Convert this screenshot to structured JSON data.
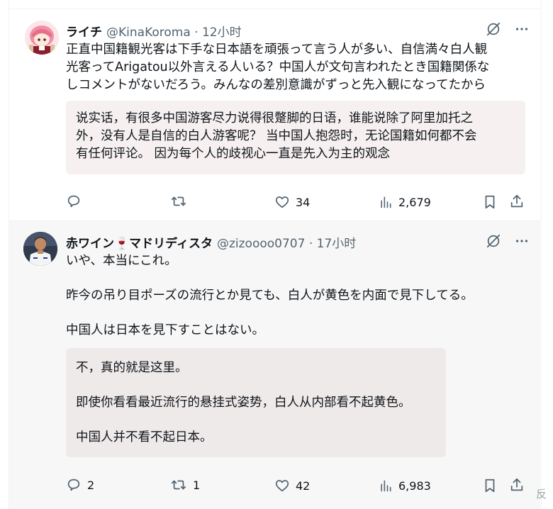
{
  "tweets": [
    {
      "author_name": "ライチ",
      "handle_time": "@KinaKoroma · 12小时",
      "text_lines": [
        "正直中国籍観光客は下手な日本語を頑張って言う人が多い、自信満々白人観",
        "光客ってArigatou以外言える人いる？中国人が文句言われたとき国籍関係な",
        "しコメントがないだろう。みんなの差別意識がずっと先入観になってたから"
      ],
      "translation_lines": [
        "说实话，有很多中国游客尽力说得很蹩脚的日语，谁能说除了阿里加托之",
        "外，没有人是自信的白人游客呢？ 当中国人抱怨时，无论国籍如何都不会",
        "有任何评论。 因为每个人的歧视心一直是先入为主的观念"
      ],
      "stats": {
        "replies": "",
        "reposts": "",
        "likes": "34",
        "views": "2,679"
      }
    },
    {
      "author_name": "赤ワイン🍷マドリディスタ",
      "handle_time": "@zizoooo0707 · 17小时",
      "paragraphs": [
        "いや、本当にこれ。",
        "昨今の吊り目ポーズの流行とか見ても、白人が黄色を内面で見下してる。",
        "中国人は日本を見下すことはない。"
      ],
      "translation_paragraphs": [
        "不，真的就是这里。",
        "即使你看看最近流行的悬挂式姿势，白人从内部看不起黄色。",
        "中国人并不看不起日本。"
      ],
      "stats": {
        "replies": "2",
        "reposts": "1",
        "likes": "42",
        "views": "6,983"
      }
    }
  ],
  "icons": {
    "grok": "grok-slash-icon",
    "more": "more-dots-icon",
    "reply": "reply-bubble-icon",
    "repost": "repost-arrows-icon",
    "like": "heart-icon",
    "views": "views-bars-icon",
    "bookmark": "bookmark-icon",
    "share": "share-upload-icon"
  },
  "colors": {
    "secondary": "#536471",
    "text": "#0f1419",
    "translation_bg": "#f6f0f0"
  },
  "corner_mark": "反"
}
